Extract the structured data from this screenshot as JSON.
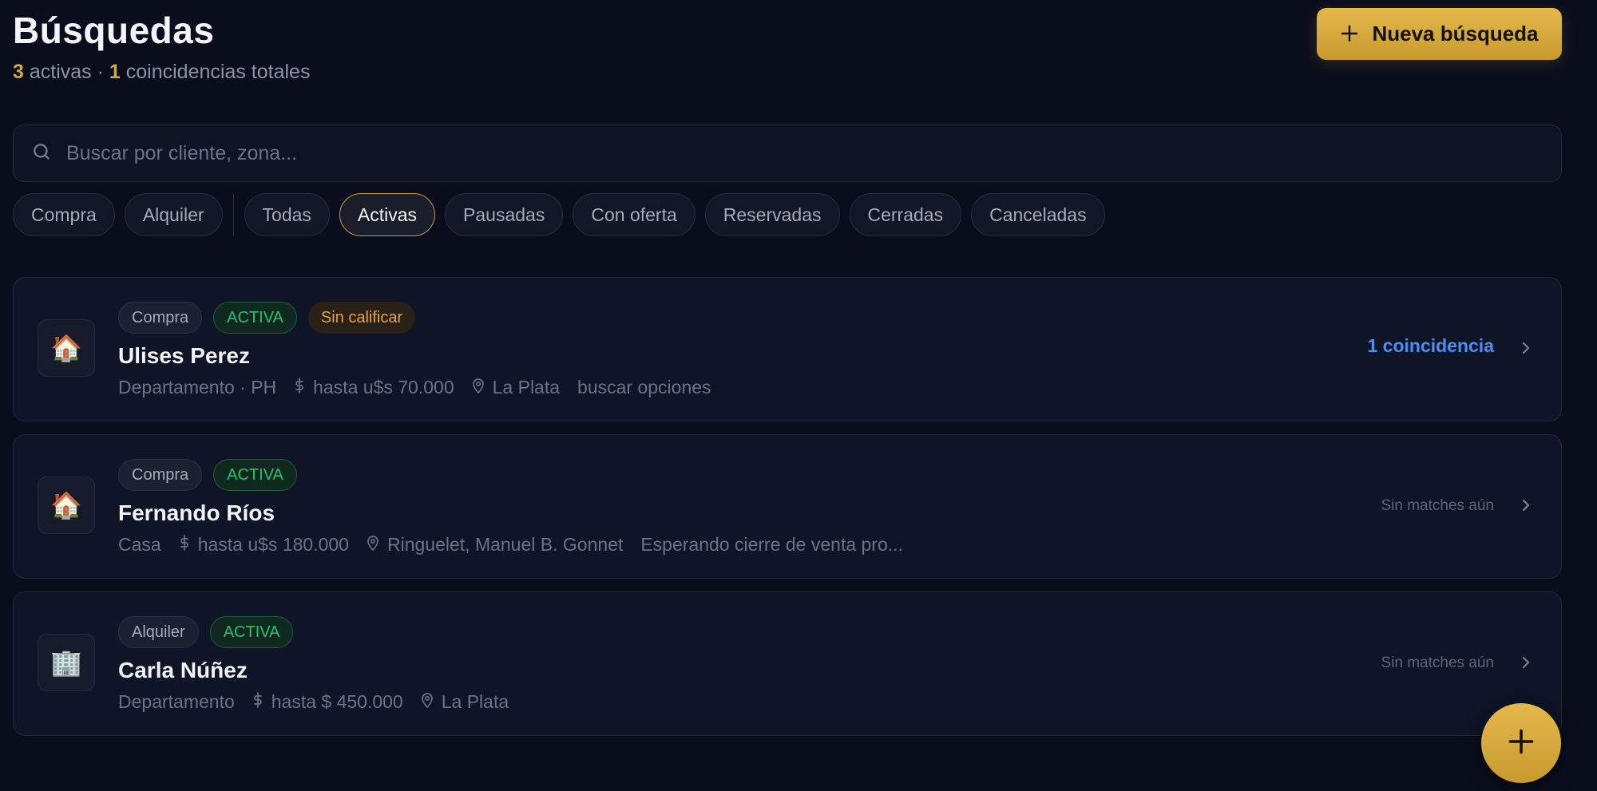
{
  "header": {
    "title": "Búsquedas",
    "active_count": "3",
    "active_label": "activas",
    "separator": "·",
    "match_count": "1",
    "match_label": "coincidencias totales",
    "new_button_label": "Nueva búsqueda"
  },
  "search": {
    "placeholder": "Buscar por cliente, zona...",
    "value": ""
  },
  "filters": {
    "operation": [
      "Compra",
      "Alquiler"
    ],
    "status": [
      "Todas",
      "Activas",
      "Pausadas",
      "Con oferta",
      "Reservadas",
      "Cerradas",
      "Canceladas"
    ],
    "selected": "Activas"
  },
  "cards": [
    {
      "icon": "🏠",
      "icon_name": "house-icon",
      "operation": "Compra",
      "status": "ACTIVA",
      "extra_tag": "Sin calificar",
      "name": "Ulises Perez",
      "property_type": "Departamento · PH",
      "budget": "hasta u$s 70.000",
      "location": "La Plata",
      "note": "buscar opciones",
      "match_text": "1 coincidencia"
    },
    {
      "icon": "🏠",
      "icon_name": "house-icon",
      "operation": "Compra",
      "status": "ACTIVA",
      "name": "Fernando Ríos",
      "property_type": "Casa",
      "budget": "hasta u$s 180.000",
      "location": "Ringuelet, Manuel B. Gonnet",
      "note": "Esperando cierre de venta pro...",
      "match_text": "Sin matches aún"
    },
    {
      "icon": "🏢",
      "icon_name": "building-icon",
      "operation": "Alquiler",
      "status": "ACTIVA",
      "name": "Carla Núñez",
      "property_type": "Departamento",
      "budget": "hasta $ 450.000",
      "location": "La Plata",
      "match_text": "Sin matches aún"
    }
  ],
  "colors": {
    "background": "#0a0e1c",
    "accent": "#d4a83a",
    "status_active": "#27c172",
    "warning": "#e8a23a",
    "match_link": "#4d8ef0"
  }
}
